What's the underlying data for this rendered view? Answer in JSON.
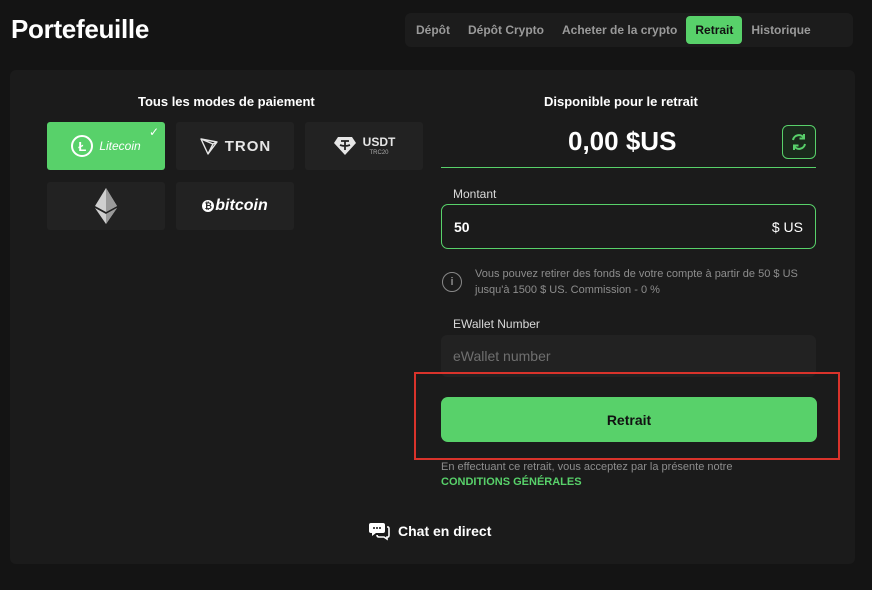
{
  "header": {
    "title": "Portefeuille"
  },
  "tabs": [
    {
      "label": "Dépôt",
      "active": false
    },
    {
      "label": "Dépôt Crypto",
      "active": false
    },
    {
      "label": "Acheter de la crypto",
      "active": false
    },
    {
      "label": "Retrait",
      "active": true
    },
    {
      "label": "Historique",
      "active": false
    }
  ],
  "payment_methods": {
    "title": "Tous les modes de paiement",
    "items": [
      {
        "name": "Litecoin",
        "label": "Litecoin",
        "icon": "litecoin-icon",
        "selected": true
      },
      {
        "name": "TRON",
        "label": "TRON",
        "icon": "tron-icon",
        "selected": false
      },
      {
        "name": "USDT TRC20",
        "label": "USDT",
        "sub": "TRC20",
        "icon": "tether-icon",
        "selected": false
      },
      {
        "name": "Ethereum",
        "label": "",
        "icon": "ethereum-icon",
        "selected": false
      },
      {
        "name": "bitcoin",
        "label": "bitcoin",
        "icon": "bitcoin-icon",
        "selected": false
      }
    ],
    "selected_check": "✓"
  },
  "withdraw": {
    "available_title": "Disponible pour le retrait",
    "balance": "0,00 $US",
    "amount_label": "Montant",
    "amount_value": "50",
    "amount_currency": "$ US",
    "info_icon": "i",
    "info_text": "Vous pouvez retirer des fonds de votre compte à partir de 50 $ US jusqu'à 1500 $ US. Commission - 0 %",
    "ewallet_label": "EWallet Number",
    "ewallet_placeholder": "eWallet number",
    "button_label": "Retrait",
    "terms_text": "En effectuant ce retrait, vous acceptez par la présente notre",
    "terms_link": "CONDITIONS GÉNÉRALES"
  },
  "chat": {
    "label": "Chat en direct"
  },
  "colors": {
    "accent": "#58d16a",
    "background": "#141414",
    "panel": "#1b1b1b",
    "highlight": "#d9332b"
  }
}
